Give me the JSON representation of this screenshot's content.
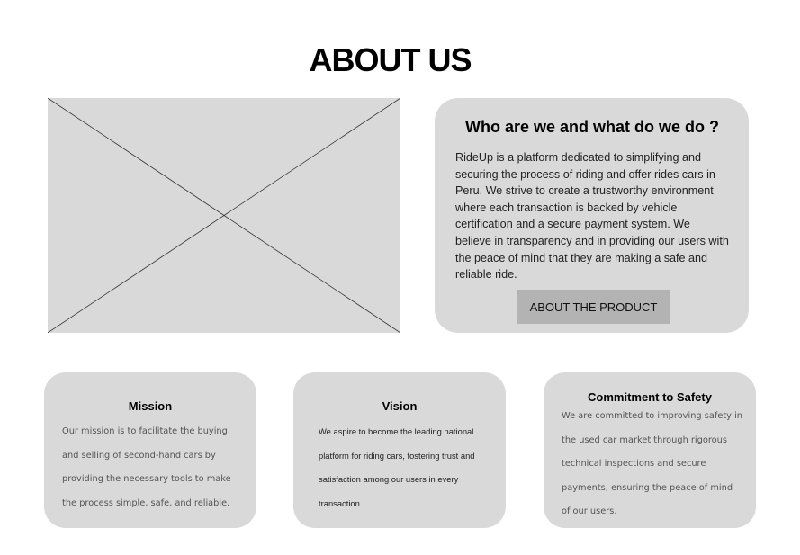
{
  "page": {
    "title": "ABOUT US"
  },
  "intro": {
    "heading": "Who are we and what do we do ?",
    "body": "RideUp is a platform dedicated to simplifying and securing the process of riding and offer rides cars in Peru. We strive to create a trustworthy environment where each transaction is backed by vehicle certification and a secure payment system. We believe in transparency and in providing our users with the peace of mind that they are making a safe and reliable ride.",
    "button_label": "ABOUT THE PRODUCT"
  },
  "cards": {
    "mission": {
      "title": "Mission",
      "body": "Our mission is to facilitate the buying and selling of second-hand cars by providing the necessary tools to make the process simple, safe, and reliable."
    },
    "vision": {
      "title": "Vision",
      "body": "We aspire to become the leading national platform for riding cars, fostering trust and satisfaction among our users in every transaction."
    },
    "safety": {
      "title": "Commitment to Safety",
      "body": "We are committed to improving safety in the used car market through rigorous technical inspections and secure payments, ensuring the peace of mind of our users."
    }
  },
  "colors": {
    "card_background": "#d9d9d9",
    "button_background": "#b3b3b3"
  },
  "icons": {
    "image_placeholder": "image-placeholder-icon"
  }
}
